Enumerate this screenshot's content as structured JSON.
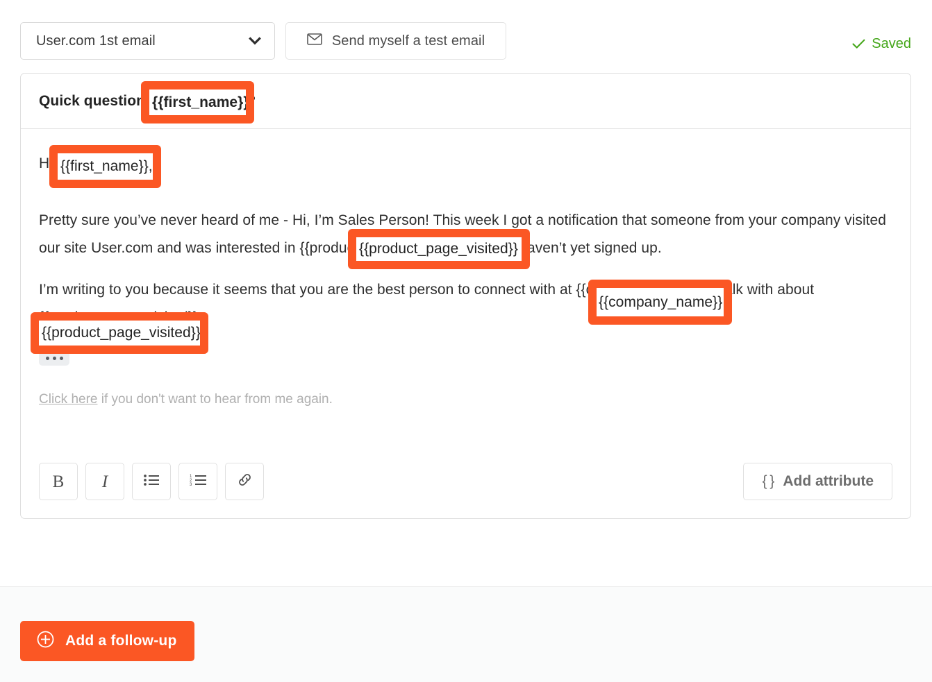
{
  "toolbar_top": {
    "email_select": {
      "value": "User.com 1st email",
      "chevron_icon": "chevron-down-icon"
    },
    "test_email_button": {
      "label": "Send myself a test email",
      "icon": "envelope-icon"
    },
    "saved_status": {
      "label": "Saved",
      "icon": "check-icon",
      "color": "#44a619"
    }
  },
  "email": {
    "subject": "Quick question {{first_name}}?",
    "greeting": "Hi {{first_name}},",
    "paragraph_1": "Pretty sure you’ve never heard of me - Hi, I’m Sales Person! This week I got a notification that someone from your company visited our site User.com and was interested in {{product_page_visited}} but they haven’t yet signed up.",
    "paragraph_2": "I’m writing to you because it seems that you are the best person to connect with at {{company_name}} to talk with about {{product_page_visited}}.",
    "more_button": "•••",
    "unsubscribe_link": "Click here",
    "unsubscribe_rest": " if you don't want to hear from me again."
  },
  "editor_toolbar": {
    "buttons": [
      {
        "name": "bold",
        "glyph": "B"
      },
      {
        "name": "italic",
        "glyph": "I"
      },
      {
        "name": "bullet-list",
        "glyph": ""
      },
      {
        "name": "numbered-list",
        "glyph": ""
      },
      {
        "name": "link",
        "glyph": ""
      }
    ],
    "add_attribute": {
      "label": "Add attribute",
      "braces": "{ }"
    }
  },
  "footer": {
    "add_follow_up": {
      "label": "Add a follow-up",
      "icon": "plus-circle-icon",
      "color": "#fb5724"
    }
  },
  "annotations": {
    "accent_color": "#fb5724",
    "boxes": [
      {
        "id": "subject-first-name",
        "text": "{{first_name}}?",
        "target": "subject line merge tag"
      },
      {
        "id": "greeting-first-name",
        "text": "{{first_name}},",
        "target": "greeting merge tag"
      },
      {
        "id": "body-product-page",
        "text": "{{product_page_visited}}",
        "target": "paragraph 1 merge tag"
      },
      {
        "id": "body-company-name",
        "text": "{{company_name}}",
        "target": "paragraph 2 merge tag"
      },
      {
        "id": "body-product-page-2",
        "text": "{{product_page_visited}}.",
        "target": "paragraph 2 merge tag"
      }
    ]
  }
}
